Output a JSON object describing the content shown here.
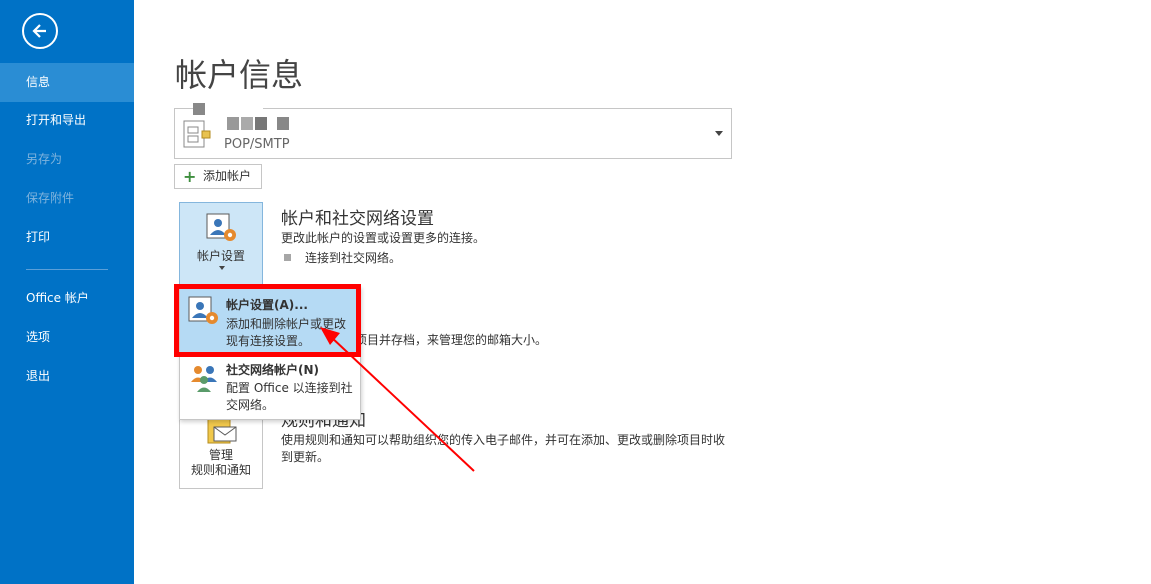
{
  "sidebar": {
    "items": [
      {
        "label": "信息"
      },
      {
        "label": "打开和导出"
      },
      {
        "label": "另存为"
      },
      {
        "label": "保存附件"
      },
      {
        "label": "打印"
      },
      {
        "label": "Office 帐户"
      },
      {
        "label": "选项"
      },
      {
        "label": "退出"
      }
    ]
  },
  "page": {
    "title": "帐户信息"
  },
  "account": {
    "type": "POP/SMTP"
  },
  "add_account_label": "添加帐户",
  "account_settings": {
    "button_label": "帐户设置",
    "title": "帐户和社交网络设置",
    "description": "更改此帐户的设置或设置更多的连接。",
    "bullet": "连接到社交网络。"
  },
  "mailbox": {
    "partial_text": "除项目并存档，来管理您的邮箱大小。"
  },
  "rules": {
    "title_partial": "规则和通知",
    "description": "使用规则和通知可以帮助组织您的传入电子邮件，并可在添加、更改或删除项目时收到更新。",
    "button_line1": "管理",
    "button_line2": "规则和通知"
  },
  "dropdown": {
    "items": [
      {
        "title": "帐户设置(A)...",
        "description": "添加和删除帐户或更改现有连接设置。"
      },
      {
        "title": "社交网络帐户(N)",
        "description": "配置 Office 以连接到社交网络。"
      }
    ]
  },
  "colors": {
    "sidebar": "#0072c6",
    "active": "#2a8dd4",
    "highlight": "#ff0000"
  },
  "icons": [
    "back-arrow-icon",
    "account-card-icon",
    "plus-icon",
    "account-settings-icon",
    "social-accounts-icon",
    "rules-icon",
    "dropdown-arrow-icon"
  ]
}
